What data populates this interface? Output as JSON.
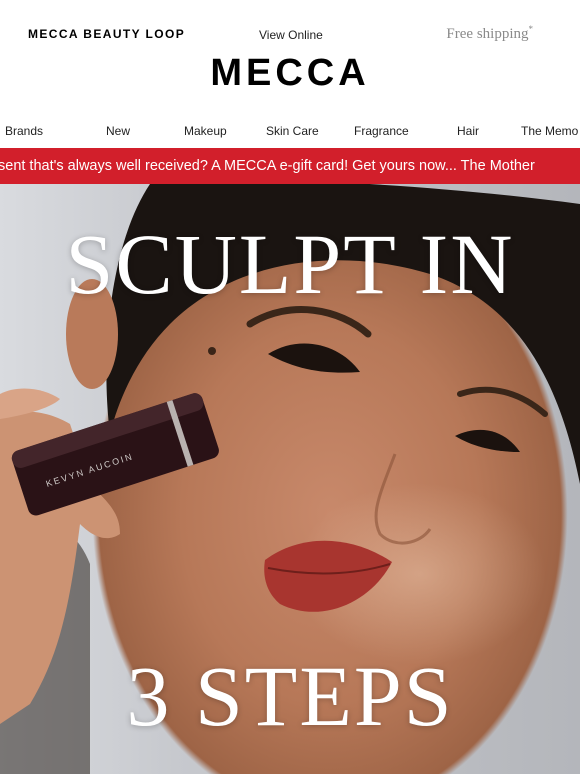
{
  "header": {
    "loop_link": "MECCA BEAUTY LOOP",
    "view_online": "View Online",
    "free_shipping": "Free shipping",
    "free_shipping_mark": "*",
    "logo": "MECCA"
  },
  "nav": {
    "items": [
      "Brands",
      "New",
      "Makeup",
      "Skin Care",
      "Fragrance",
      "Hair",
      "The Memo"
    ]
  },
  "banner": {
    "text": "sent that's always well received? A MECCA e-gift card! Get yours now...  The Mother"
  },
  "hero": {
    "headline_top": "SCULPT IN",
    "headline_bottom": "3 STEPS",
    "product_brand": "KEVYN AUCOIN"
  },
  "colors": {
    "banner_red": "#d21f2b",
    "muted_gray": "#8a8a8a"
  }
}
